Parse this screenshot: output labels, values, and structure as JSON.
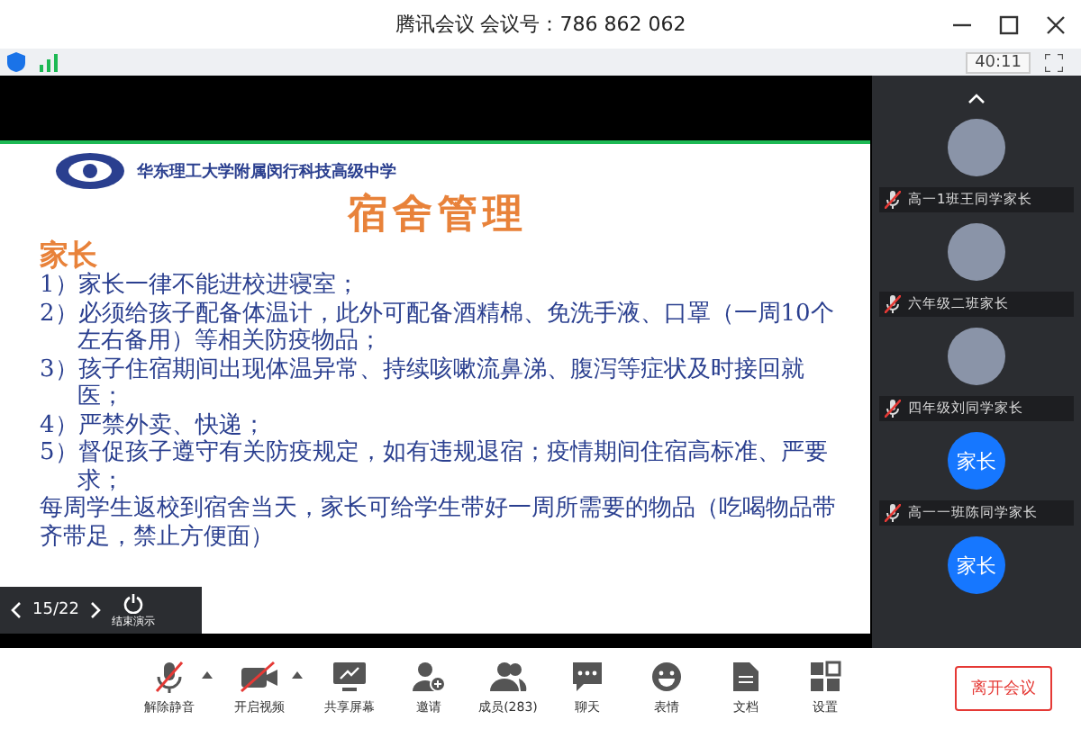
{
  "window": {
    "title": "腾讯会议 会议号：786 862 062"
  },
  "info_bar": {
    "timer": "40:11"
  },
  "slide": {
    "school": "华东理工大学附属闵行科技高级中学",
    "title": "宿舍管理",
    "heading": "家长",
    "items": [
      {
        "kind": "numbered",
        "text": "1）家长一律不能进校进寝室；"
      },
      {
        "kind": "numbered",
        "text": "2）必须给孩子配备体温计，此外可配备酒精棉、免洗手液、口罩（一周10个左右备用）等相关防疫物品；"
      },
      {
        "kind": "numbered",
        "text": "3）孩子住宿期间出现体温异常、持续咳嗽流鼻涕、腹泻等症状及时接回就医；"
      },
      {
        "kind": "numbered",
        "text": "4）严禁外卖、快递；"
      },
      {
        "kind": "numbered",
        "text": "5）督促孩子遵守有关防疫规定，如有违规退宿；疫情期间住宿高标准、严要求；"
      },
      {
        "kind": "plain",
        "text": "每周学生返校到宿舍当天，家长可给学生带好一周所需要的物品（吃喝物品带齐带足，禁止方便面）"
      }
    ],
    "page": "15/22",
    "end_label": "结束演示"
  },
  "participants": [
    {
      "kind": "photo",
      "name": "高一1班王同学家长",
      "muted": true
    },
    {
      "kind": "photo",
      "name": "六年级二班家长",
      "muted": true
    },
    {
      "kind": "photo",
      "name": "四年级刘同学家长",
      "muted": true
    },
    {
      "kind": "text",
      "avatar": "家长",
      "name": "高一一班陈同学家长",
      "muted": true
    },
    {
      "kind": "text",
      "avatar": "家长"
    }
  ],
  "toolbar": [
    {
      "kind": "mic",
      "label": "解除静音",
      "off": true,
      "caret": true
    },
    {
      "kind": "video",
      "label": "开启视频",
      "off": true,
      "caret": true
    },
    {
      "kind": "share",
      "label": "共享屏幕"
    },
    {
      "kind": "invite",
      "label": "邀请"
    },
    {
      "kind": "members",
      "label": "成员(283)"
    },
    {
      "kind": "chat",
      "label": "聊天"
    },
    {
      "kind": "emoji",
      "label": "表情"
    },
    {
      "kind": "doc",
      "label": "文档"
    },
    {
      "kind": "settings",
      "label": "设置"
    }
  ],
  "leave_button": "离开会议"
}
